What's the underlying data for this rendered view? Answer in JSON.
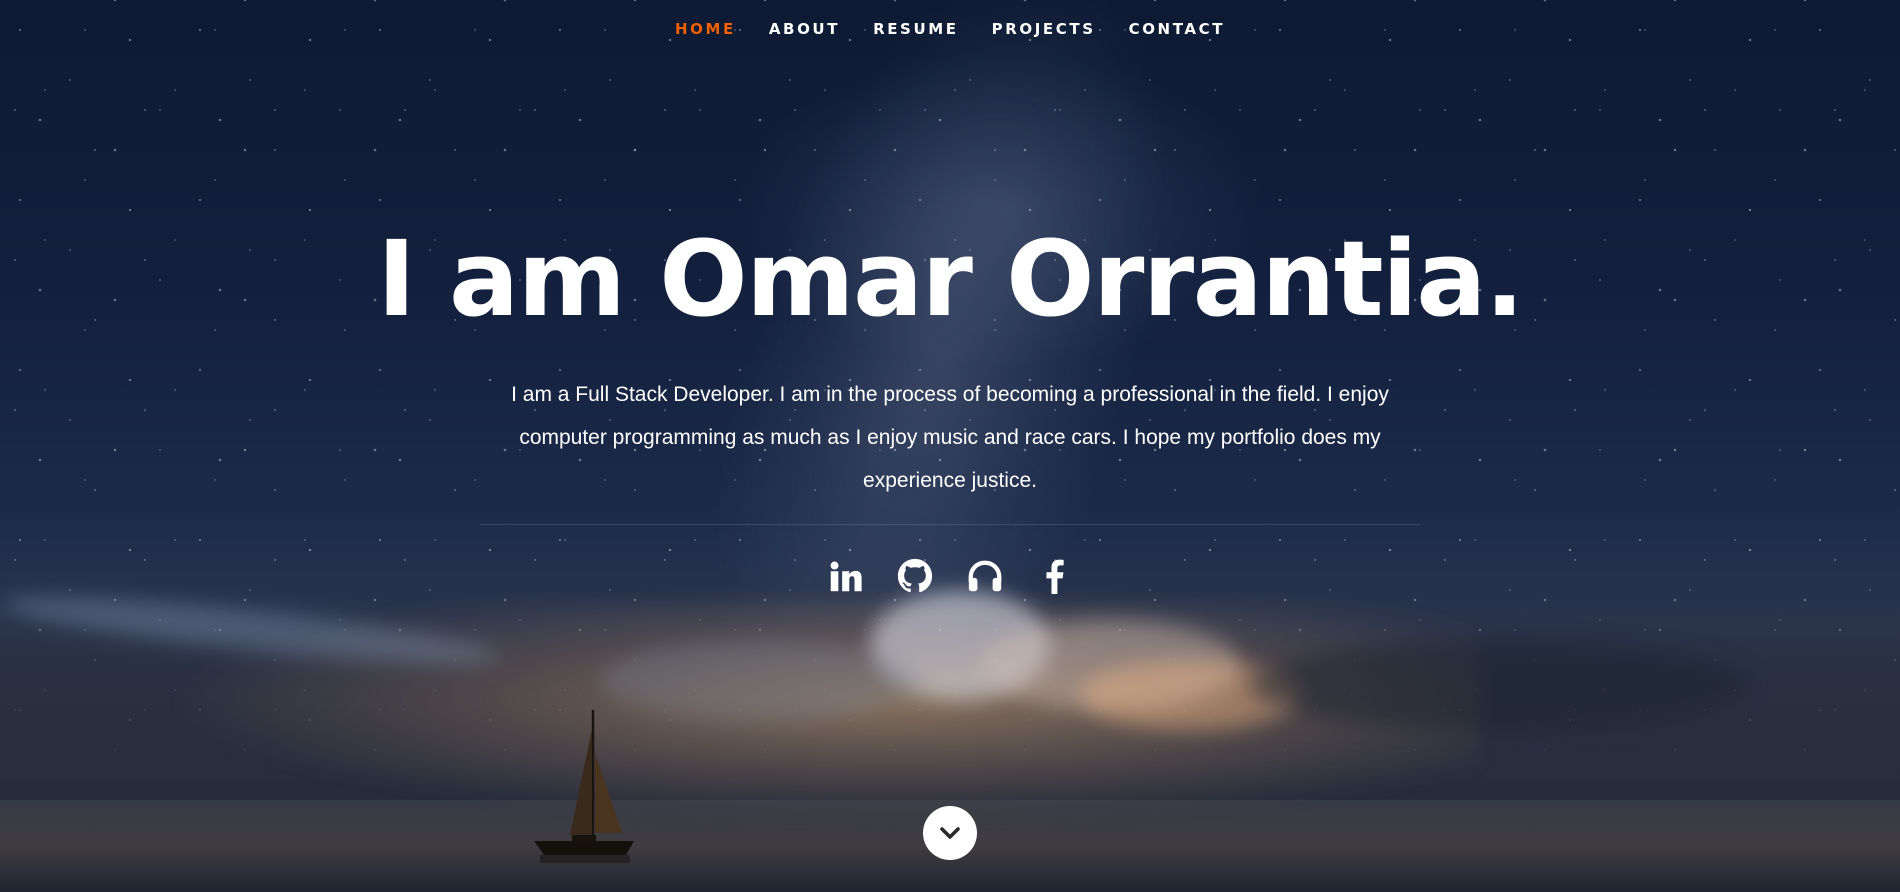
{
  "nav": {
    "items": [
      {
        "label": "HOME",
        "active": true
      },
      {
        "label": "ABOUT",
        "active": false
      },
      {
        "label": "RESUME",
        "active": false
      },
      {
        "label": "PROJECTS",
        "active": false
      },
      {
        "label": "CONTACT",
        "active": false
      }
    ],
    "active_color": "#f06000",
    "text_color": "#ffffff"
  },
  "hero": {
    "headline": "I am Omar Orrantia.",
    "intro": "I am a Full Stack Developer. I am in the process of becoming a professional in the field. I enjoy computer programming as much as I enjoy music and race cars. I hope my portfolio does my experience justice."
  },
  "social": {
    "icons": [
      "linkedin-icon",
      "github-icon",
      "headphones-icon",
      "facebook-icon"
    ]
  },
  "scroll_button": {
    "icon": "chevron-down-icon"
  }
}
